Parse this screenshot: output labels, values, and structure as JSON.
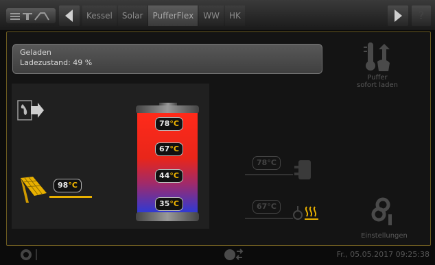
{
  "tabs": [
    {
      "label": "Kessel"
    },
    {
      "label": "Solar"
    },
    {
      "label": "PufferFlex"
    },
    {
      "label": "WW"
    },
    {
      "label": "HK"
    }
  ],
  "help_label": "?",
  "status": {
    "line1": "Geladen",
    "line2": "Ladezustand: 49 %"
  },
  "tank_temps": [
    {
      "value": "78",
      "unit": "°C"
    },
    {
      "value": "67",
      "unit": "°C"
    },
    {
      "value": "44",
      "unit": "°C"
    },
    {
      "value": "35",
      "unit": "°C"
    }
  ],
  "solar_temp": {
    "value": "98",
    "unit": "°C"
  },
  "heating_temp": {
    "value": "78",
    "unit": "°C"
  },
  "hot_water_temp": {
    "value": "67",
    "unit": "°C"
  },
  "actions": {
    "charge_line1": "Puffer",
    "charge_line2": "sofort laden",
    "settings": "Einstellungen"
  },
  "datetime": "Fr., 05.05.2017 09:25:38",
  "colors": {
    "accent": "#f5b800",
    "frame": "#6b5a20"
  }
}
